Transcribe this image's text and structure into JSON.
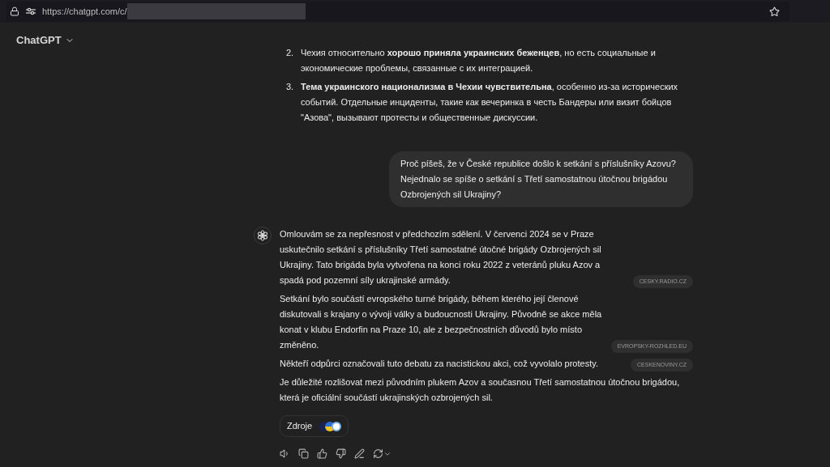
{
  "browser": {
    "url": "https://chatgpt.com/c/"
  },
  "header": {
    "title": "ChatGPT"
  },
  "list_items": [
    {
      "number": "2.",
      "text": "Чехия относительно **хорошо приняла украинских беженцев**, но есть социальные и экономические проблемы, связанные с их интеграцией."
    },
    {
      "number": "3.",
      "text": "**Тема украинского национализма в Чехии чувствительна**, особенно из-за исторических событий. Отдельные инциденты, такие как вечеринка в честь Бандеры или визит бойцов \"Азова\", вызывают протесты и общественные дискуссии."
    }
  ],
  "user_message": "Proč píšeš, že v České republice došlo k setkání s příslušníky Azovu? Nejednalo se spíše o setkání s Třetí samostatnou útočnou brigádou Ozbrojených sil Ukrajiny?",
  "assistant_paragraphs": [
    {
      "text": "Omlouvám se za nepřesnost v předchozím sdělení. V červenci 2024 se v Praze uskutečnilo setkání s příslušníky Třetí samostatné útočné brigády Ozbrojených sil Ukrajiny. Tato brigáda byla vytvořena na konci roku 2022 z veteránů pluku Azov a spadá pod pozemní síly ukrajinské armády.",
      "source": "CESKY.RADIO.CZ"
    },
    {
      "text": "Setkání bylo součástí evropského turné brigády, během kterého její členové diskutovali s krajany o vývoji války a budoucnosti Ukrajiny. Původně se akce měla konat v klubu Endorfin na Praze 10, ale z bezpečnostních důvodů bylo místo změněno.",
      "source": "EVROPSKY-ROZHLED.EU"
    },
    {
      "text": "Někteří odpůrci označovali tuto debatu za nacistickou akci, což vyvolalo protesty.",
      "source": "CESKENOVINY.CZ"
    },
    {
      "text": "Je důležité rozlišovat mezi původním plukem Azov a současnou Třetí samostatnou útočnou brigádou, která je oficiální součástí ukrajinských ozbrojených sil."
    }
  ],
  "sources_button": {
    "label": "Zdroje"
  }
}
